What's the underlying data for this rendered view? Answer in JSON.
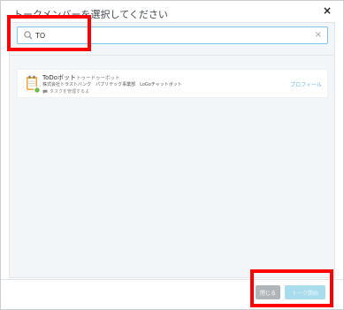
{
  "dialog": {
    "title": "トークメンバーを選択してください",
    "close_symbol": "×"
  },
  "search": {
    "value": "TO",
    "placeholder": "",
    "clear_symbol": "×"
  },
  "results": [
    {
      "name": "ToDoボット",
      "alias": "トゥードゥーボット",
      "organization": "株式会社トラストバンク　パブリテック事業部　LoGoチャットボット",
      "status": "タスクを管理するよ",
      "profile_label": "プロフィール"
    }
  ],
  "footer": {
    "close_label": "閉じる",
    "start_label": "トーク開始"
  },
  "colors": {
    "accent": "#7fc6e8",
    "link": "#67b8e3",
    "highlight": "#ff0000",
    "online": "#6cc04a"
  },
  "icons": {
    "search": "search-icon",
    "clear": "clear-icon",
    "close": "close-icon",
    "bot_avatar": "notepad-bot-icon",
    "status": "speech-bubble-icon"
  }
}
